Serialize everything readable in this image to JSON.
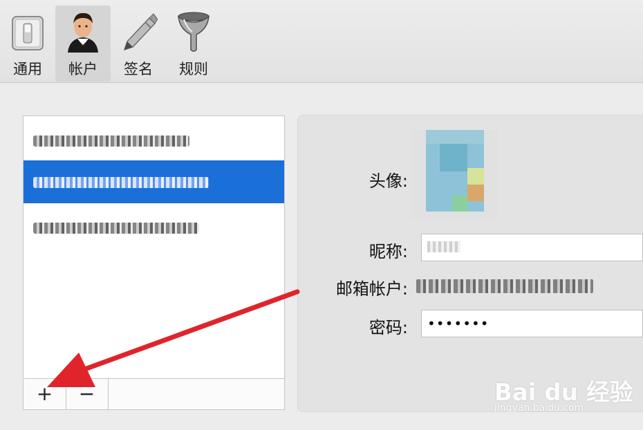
{
  "toolbar": {
    "items": [
      {
        "label": "通用",
        "icon": "general-switch-icon",
        "active": false
      },
      {
        "label": "帐户",
        "icon": "account-user-icon",
        "active": true
      },
      {
        "label": "签名",
        "icon": "pen-icon",
        "active": false
      },
      {
        "label": "规则",
        "icon": "funnel-icon",
        "active": false
      }
    ]
  },
  "account_list": {
    "items": [
      {
        "text": "",
        "selected": false
      },
      {
        "text": "",
        "selected": true
      },
      {
        "text": "",
        "selected": false
      }
    ],
    "add_label": "+",
    "remove_label": "−"
  },
  "detail": {
    "avatar_label": "头像:",
    "nickname_label": "昵称:",
    "email_label": "邮箱帐户:",
    "password_label": "密码:",
    "password_value": "•••••••"
  },
  "colors": {
    "selection": "#1a6fd9",
    "arrow": "#e0242b"
  },
  "watermark": {
    "main": "Bai du 经验",
    "sub": "jingyan.baidu.com"
  }
}
